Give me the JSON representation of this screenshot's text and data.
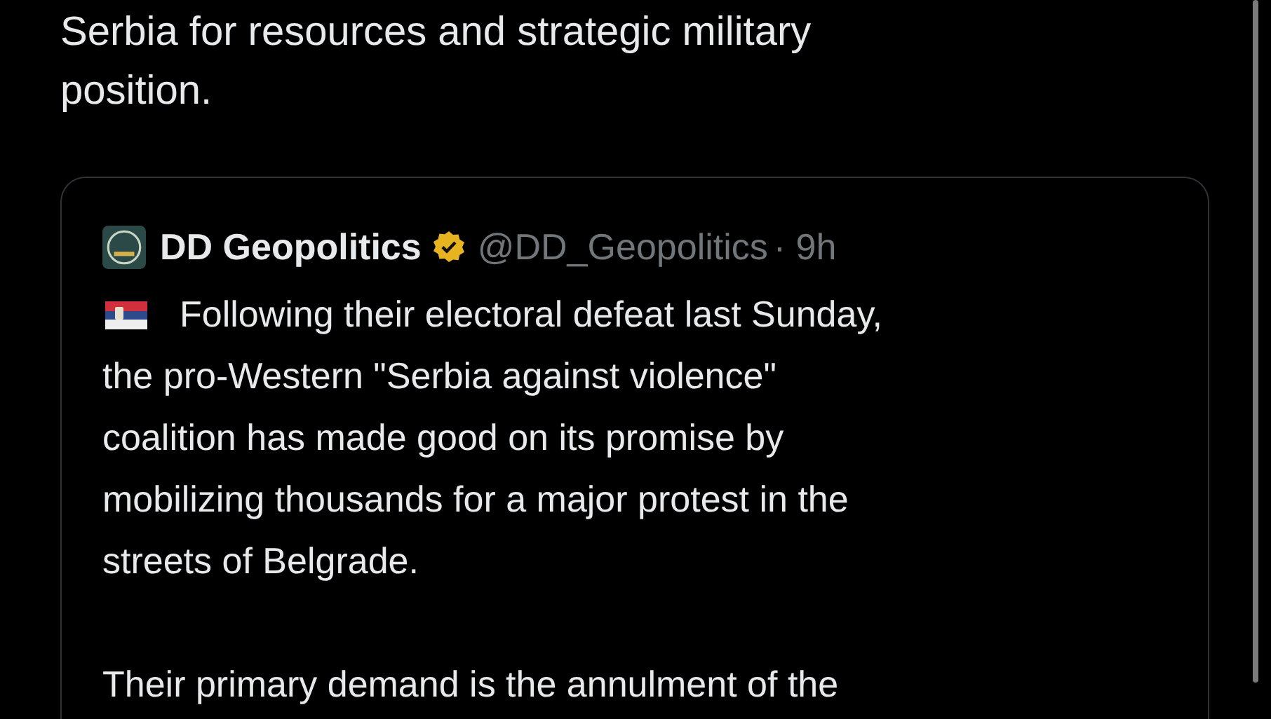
{
  "post": {
    "text_lines": [
      "Serbia for resources and strategic military",
      "position."
    ]
  },
  "quoted_post": {
    "author": {
      "name": "DD Geopolitics",
      "verified": true,
      "handle": "@DD_Geopolitics",
      "time": "· 9h"
    },
    "paragraphs": [
      {
        "flag": true,
        "lines": [
          "Following their electoral defeat last Sunday,",
          "the pro-Western \"Serbia against violence\"",
          "coalition has made good on its promise by",
          "mobilizing thousands for a major protest in the",
          "streets of Belgrade."
        ]
      },
      {
        "flag": false,
        "lines": [
          "Their primary demand is the annulment of the"
        ]
      }
    ]
  }
}
